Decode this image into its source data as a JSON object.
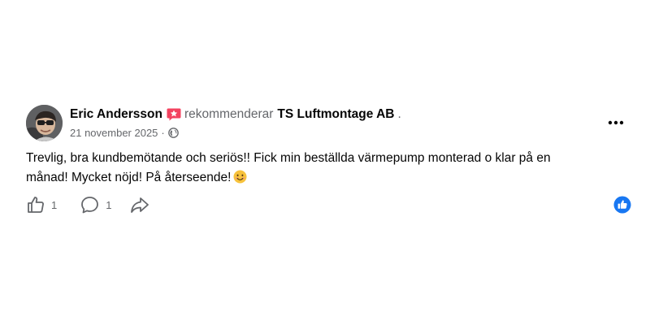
{
  "post": {
    "author": "Eric Andersson",
    "action_verb": "rekommenderar",
    "page_name": "TS Luftmontage AB",
    "trailing": ".",
    "date": "21 november 2025",
    "separator": "·",
    "text_line1": "Trevlig, bra kundbemötande och seriös!! Fick min beställda värmepump monterad o klar på en",
    "text_line2": "månad! Mycket nöjd! På återseende!",
    "like_count": "1",
    "comment_count": "1"
  },
  "icons": {
    "recommendation_badge": "recommend-star-icon",
    "audience": "globe-icon",
    "more": "more-options-icon",
    "emoji": "smiling-face-emoji",
    "like": "thumbs-up-icon",
    "comment": "comment-bubble-icon",
    "share": "share-arrow-icon",
    "reaction": "like-reaction-icon"
  },
  "colors": {
    "text_primary": "#050505",
    "text_secondary": "#65676b",
    "badge": "#f3425f",
    "reaction_blue": "#1877f2"
  }
}
